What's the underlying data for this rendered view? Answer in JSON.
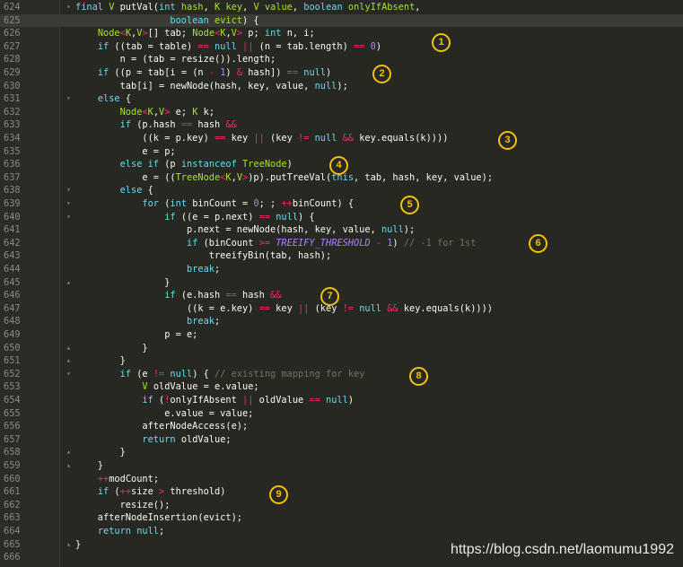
{
  "editor": {
    "current_line": 625,
    "lines": [
      {
        "num": "624",
        "parts": [
          [
            "kw",
            "final "
          ],
          [
            "ty",
            "V "
          ],
          [
            "pl",
            "putVal("
          ],
          [
            "kw",
            "int "
          ],
          [
            "ty",
            "hash"
          ],
          [
            "pl",
            ", "
          ],
          [
            "ty",
            "K "
          ],
          [
            "ty",
            "key"
          ],
          [
            "pl",
            ", "
          ],
          [
            "ty",
            "V "
          ],
          [
            "ty",
            "value"
          ],
          [
            "pl",
            ", "
          ],
          [
            "kw",
            "boolean "
          ],
          [
            "ty",
            "onlyIfAbsent"
          ],
          [
            "pl",
            ","
          ]
        ]
      },
      {
        "num": "625",
        "parts": [
          [
            "pl",
            "                 "
          ],
          [
            "kw",
            "boolean "
          ],
          [
            "ty",
            "evict"
          ],
          [
            "pl",
            ") {"
          ]
        ]
      },
      {
        "num": "626",
        "parts": [
          [
            "pl",
            "    "
          ],
          [
            "ty",
            "Node"
          ],
          [
            "op",
            "<"
          ],
          [
            "ty",
            "K"
          ],
          [
            "pl",
            ","
          ],
          [
            "ty",
            "V"
          ],
          [
            "op",
            ">"
          ],
          [
            "pl",
            "[] tab; "
          ],
          [
            "ty",
            "Node"
          ],
          [
            "op",
            "<"
          ],
          [
            "ty",
            "K"
          ],
          [
            "pl",
            ","
          ],
          [
            "ty",
            "V"
          ],
          [
            "op",
            ">"
          ],
          [
            "pl",
            " p; "
          ],
          [
            "kw",
            "int "
          ],
          [
            "pl",
            "n, i;"
          ]
        ]
      },
      {
        "num": "627",
        "parts": [
          [
            "pl",
            "    "
          ],
          [
            "kw",
            "if "
          ],
          [
            "pl",
            "((tab = table) "
          ],
          [
            "op",
            "=="
          ],
          [
            "kw",
            " null "
          ],
          [
            "op",
            "||"
          ],
          [
            "pl",
            " (n = tab.length) "
          ],
          [
            "op",
            "=="
          ],
          [
            "nb",
            " 0"
          ],
          [
            "pl",
            ")"
          ]
        ]
      },
      {
        "num": "628",
        "parts": [
          [
            "pl",
            "        n = (tab = resize()).length;"
          ]
        ]
      },
      {
        "num": "629",
        "parts": [
          [
            "pl",
            "    "
          ],
          [
            "kw",
            "if "
          ],
          [
            "pl",
            "((p = tab[i = (n "
          ],
          [
            "op",
            "-"
          ],
          [
            "nb",
            " 1"
          ],
          [
            "pl",
            ") "
          ],
          [
            "op",
            "&"
          ],
          [
            "pl",
            " hash]) "
          ],
          [
            "op",
            "=="
          ],
          [
            "kw",
            " null"
          ],
          [
            "pl",
            ")"
          ]
        ]
      },
      {
        "num": "630",
        "parts": [
          [
            "pl",
            "        tab[i] = newNode(hash, key, value, "
          ],
          [
            "kw",
            "null"
          ],
          [
            "pl",
            ");"
          ]
        ]
      },
      {
        "num": "631",
        "parts": [
          [
            "pl",
            "    "
          ],
          [
            "kw",
            "else "
          ],
          [
            "pl",
            "{"
          ]
        ]
      },
      {
        "num": "632",
        "parts": [
          [
            "pl",
            "        "
          ],
          [
            "ty",
            "Node"
          ],
          [
            "op",
            "<"
          ],
          [
            "ty",
            "K"
          ],
          [
            "pl",
            ","
          ],
          [
            "ty",
            "V"
          ],
          [
            "op",
            ">"
          ],
          [
            "pl",
            " e; "
          ],
          [
            "ty",
            "K "
          ],
          [
            "pl",
            "k;"
          ]
        ]
      },
      {
        "num": "633",
        "parts": [
          [
            "pl",
            "        "
          ],
          [
            "kw",
            "if "
          ],
          [
            "pl",
            "(p.hash "
          ],
          [
            "op",
            "=="
          ],
          [
            "pl",
            " hash "
          ],
          [
            "op",
            "&&"
          ]
        ]
      },
      {
        "num": "634",
        "parts": [
          [
            "pl",
            "            ((k = p.key) "
          ],
          [
            "op",
            "=="
          ],
          [
            "pl",
            " key "
          ],
          [
            "op",
            "||"
          ],
          [
            "pl",
            " (key "
          ],
          [
            "op",
            "!="
          ],
          [
            "kw",
            " null "
          ],
          [
            "op",
            "&&"
          ],
          [
            "pl",
            " key.equals(k))))"
          ]
        ]
      },
      {
        "num": "635",
        "parts": [
          [
            "pl",
            "            e = p;"
          ]
        ]
      },
      {
        "num": "636",
        "parts": [
          [
            "pl",
            "        "
          ],
          [
            "kw",
            "else if "
          ],
          [
            "pl",
            "(p "
          ],
          [
            "kw",
            "instanceof "
          ],
          [
            "ty",
            "TreeNode"
          ],
          [
            "pl",
            ")"
          ]
        ]
      },
      {
        "num": "637",
        "parts": [
          [
            "pl",
            "            e = (("
          ],
          [
            "ty",
            "TreeNode"
          ],
          [
            "op",
            "<"
          ],
          [
            "ty",
            "K"
          ],
          [
            "pl",
            ","
          ],
          [
            "ty",
            "V"
          ],
          [
            "op",
            ">"
          ],
          [
            "pl",
            ")p).putTreeVal("
          ],
          [
            "kw",
            "this"
          ],
          [
            "pl",
            ", tab, hash, key, value);"
          ]
        ]
      },
      {
        "num": "638",
        "parts": [
          [
            "pl",
            "        "
          ],
          [
            "kw",
            "else "
          ],
          [
            "pl",
            "{"
          ]
        ]
      },
      {
        "num": "639",
        "parts": [
          [
            "pl",
            "            "
          ],
          [
            "kw",
            "for "
          ],
          [
            "pl",
            "("
          ],
          [
            "kw",
            "int "
          ],
          [
            "pl",
            "binCount = "
          ],
          [
            "nb",
            "0"
          ],
          [
            "pl",
            "; ; "
          ],
          [
            "op",
            "++"
          ],
          [
            "pl",
            "binCount) {"
          ]
        ]
      },
      {
        "num": "640",
        "parts": [
          [
            "pl",
            "                "
          ],
          [
            "kw",
            "if "
          ],
          [
            "pl",
            "((e = p.next) "
          ],
          [
            "op",
            "=="
          ],
          [
            "kw",
            " null"
          ],
          [
            "pl",
            ") {"
          ]
        ]
      },
      {
        "num": "641",
        "parts": [
          [
            "pl",
            "                    p.next = newNode(hash, key, value, "
          ],
          [
            "kw",
            "null"
          ],
          [
            "pl",
            ");"
          ]
        ]
      },
      {
        "num": "642",
        "parts": [
          [
            "pl",
            "                    "
          ],
          [
            "kw",
            "if "
          ],
          [
            "pl",
            "(binCount "
          ],
          [
            "op",
            ">="
          ],
          [
            "it",
            " TREEIFY_THRESHOLD "
          ],
          [
            "op",
            "-"
          ],
          [
            "nb",
            " 1"
          ],
          [
            "pl",
            ") "
          ],
          [
            "cm",
            "// -1 for 1st"
          ]
        ]
      },
      {
        "num": "643",
        "parts": [
          [
            "pl",
            "                        treeifyBin(tab, hash);"
          ]
        ]
      },
      {
        "num": "644",
        "parts": [
          [
            "pl",
            "                    "
          ],
          [
            "kw",
            "break"
          ],
          [
            "pl",
            ";"
          ]
        ]
      },
      {
        "num": "645",
        "parts": [
          [
            "pl",
            "                }"
          ]
        ]
      },
      {
        "num": "646",
        "parts": [
          [
            "pl",
            "                "
          ],
          [
            "kw",
            "if "
          ],
          [
            "pl",
            "(e.hash "
          ],
          [
            "op",
            "=="
          ],
          [
            "pl",
            " hash "
          ],
          [
            "op",
            "&&"
          ]
        ]
      },
      {
        "num": "647",
        "parts": [
          [
            "pl",
            "                    ((k = e.key) "
          ],
          [
            "op",
            "=="
          ],
          [
            "pl",
            " key "
          ],
          [
            "op",
            "||"
          ],
          [
            "pl",
            " (key "
          ],
          [
            "op",
            "!="
          ],
          [
            "kw",
            " null "
          ],
          [
            "op",
            "&&"
          ],
          [
            "pl",
            " key.equals(k))))"
          ]
        ]
      },
      {
        "num": "648",
        "parts": [
          [
            "pl",
            "                    "
          ],
          [
            "kw",
            "break"
          ],
          [
            "pl",
            ";"
          ]
        ]
      },
      {
        "num": "649",
        "parts": [
          [
            "pl",
            "                p = e;"
          ]
        ]
      },
      {
        "num": "650",
        "parts": [
          [
            "pl",
            "            }"
          ]
        ]
      },
      {
        "num": "651",
        "parts": [
          [
            "pl",
            "        }"
          ]
        ]
      },
      {
        "num": "652",
        "parts": [
          [
            "pl",
            "        "
          ],
          [
            "kw",
            "if "
          ],
          [
            "pl",
            "(e "
          ],
          [
            "op",
            "!="
          ],
          [
            "kw",
            " null"
          ],
          [
            "pl",
            ") { "
          ],
          [
            "cm",
            "// existing mapping for key"
          ]
        ]
      },
      {
        "num": "653",
        "parts": [
          [
            "pl",
            "            "
          ],
          [
            "ty",
            "V "
          ],
          [
            "pl",
            "oldValue = e.value;"
          ]
        ]
      },
      {
        "num": "654",
        "parts": [
          [
            "pl",
            "            "
          ],
          [
            "kw",
            "if "
          ],
          [
            "pl",
            "("
          ],
          [
            "op",
            "!"
          ],
          [
            "pl",
            "onlyIfAbsent "
          ],
          [
            "op",
            "||"
          ],
          [
            "pl",
            " oldValue "
          ],
          [
            "op",
            "=="
          ],
          [
            "kw",
            " null"
          ],
          [
            "pl",
            ")"
          ]
        ]
      },
      {
        "num": "655",
        "parts": [
          [
            "pl",
            "                e.value = value;"
          ]
        ]
      },
      {
        "num": "656",
        "parts": [
          [
            "pl",
            "            afterNodeAccess(e);"
          ]
        ]
      },
      {
        "num": "657",
        "parts": [
          [
            "pl",
            "            "
          ],
          [
            "kw",
            "return "
          ],
          [
            "pl",
            "oldValue;"
          ]
        ]
      },
      {
        "num": "658",
        "parts": [
          [
            "pl",
            "        }"
          ]
        ]
      },
      {
        "num": "659",
        "parts": [
          [
            "pl",
            "    }"
          ]
        ]
      },
      {
        "num": "660",
        "parts": [
          [
            "pl",
            "    "
          ],
          [
            "op",
            "++"
          ],
          [
            "pl",
            "modCount;"
          ]
        ]
      },
      {
        "num": "661",
        "parts": [
          [
            "pl",
            "    "
          ],
          [
            "kw",
            "if "
          ],
          [
            "pl",
            "("
          ],
          [
            "op",
            "++"
          ],
          [
            "pl",
            "size "
          ],
          [
            "op",
            ">"
          ],
          [
            "pl",
            " threshold)"
          ]
        ]
      },
      {
        "num": "662",
        "parts": [
          [
            "pl",
            "        resize();"
          ]
        ]
      },
      {
        "num": "663",
        "parts": [
          [
            "pl",
            "    afterNodeInsertion(evict);"
          ]
        ]
      },
      {
        "num": "664",
        "parts": [
          [
            "pl",
            "    "
          ],
          [
            "kw",
            "return null"
          ],
          [
            "pl",
            ";"
          ]
        ]
      },
      {
        "num": "665",
        "parts": [
          [
            "pl",
            "}"
          ]
        ]
      },
      {
        "num": "666",
        "parts": []
      }
    ]
  },
  "badges": [
    "1",
    "2",
    "3",
    "4",
    "5",
    "6",
    "7",
    "8",
    "9"
  ],
  "watermark": "https://blog.csdn.net/laomumu1992",
  "colors": {
    "background": "#272822",
    "keyword": "#66d9ef",
    "type": "#a6e22e",
    "operator": "#f92672",
    "number": "#ae81ff",
    "badge": "#f2c10c"
  }
}
